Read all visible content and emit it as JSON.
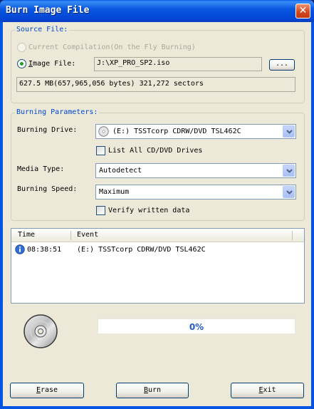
{
  "window": {
    "title": "Burn Image File",
    "close_glyph": "✕"
  },
  "source": {
    "legend": "Source File:",
    "current_compilation_label": "Current Compilation(On the Fly Burning)",
    "image_file_label": "Image File:",
    "image_file_path": "J:\\XP_PRO_SP2.iso",
    "browse_label": "...",
    "info": "627.5 MB(657,965,056 bytes)  321,272 sectors"
  },
  "burning": {
    "legend": "Burning Parameters:",
    "drive_label": "Burning Drive:",
    "drive_value": "(E:) TSSTcorp CDRW/DVD TSL462C",
    "list_all_label": "List All CD/DVD Drives",
    "list_all_checked": false,
    "media_type_label": "Media Type:",
    "media_type_value": "Autodetect",
    "speed_label": "Burning Speed:",
    "speed_value": "Maximum",
    "verify_label": "Verify written data",
    "verify_checked": false
  },
  "log": {
    "columns": [
      "Time",
      "Event"
    ],
    "rows": [
      {
        "icon": "info-icon",
        "time": "08:38:51",
        "event": "(E:) TSSTcorp CDRW/DVD TSL462C"
      }
    ]
  },
  "progress": {
    "percent": 0,
    "text": "0%"
  },
  "buttons": {
    "erase": "Erase",
    "burn": "Burn",
    "exit": "Exit"
  },
  "colors": {
    "legend": "#0046d5",
    "titlebar": "#0054e3",
    "face": "#ece9d8",
    "progress_text": "#215dc6"
  }
}
